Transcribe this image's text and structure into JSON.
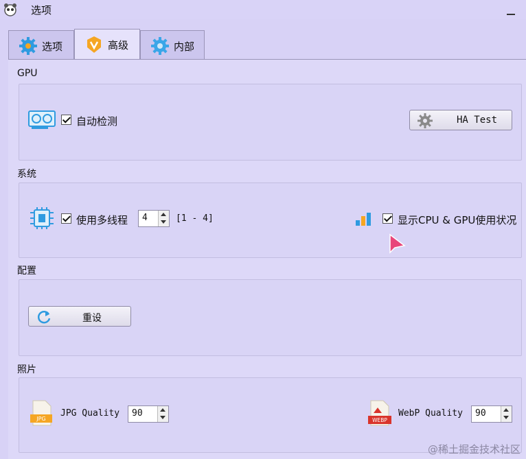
{
  "window": {
    "title": "选项"
  },
  "tabs": [
    {
      "label": "选项",
      "icon": "gear-icon",
      "active": false
    },
    {
      "label": "高级",
      "icon": "v-badge-icon",
      "active": true
    },
    {
      "label": "内部",
      "icon": "gear-icon",
      "active": false
    }
  ],
  "gpu": {
    "section_title": "GPU",
    "auto_detect_label": "自动检测",
    "auto_detect_checked": true,
    "ha_test_label": "HA Test"
  },
  "system": {
    "section_title": "系统",
    "multithread_label": "使用多线程",
    "multithread_checked": true,
    "thread_count": "4",
    "thread_range": "[1 - 4]",
    "show_usage_label": "显示CPU & GPU使用状况",
    "show_usage_checked": true
  },
  "config": {
    "section_title": "配置",
    "reset_label": "重设"
  },
  "photo": {
    "section_title": "照片",
    "jpg_label": "JPG Quality",
    "jpg_value": "90",
    "jpg_icon_text": "JPG",
    "webp_label": "WebP Quality",
    "webp_value": "90",
    "webp_icon_text": "WEBP"
  },
  "watermark": "@稀土掘金技术社区",
  "colors": {
    "accent_blue": "#2f9be0",
    "accent_orange": "#f5a623",
    "webp_red": "#d9342b"
  }
}
